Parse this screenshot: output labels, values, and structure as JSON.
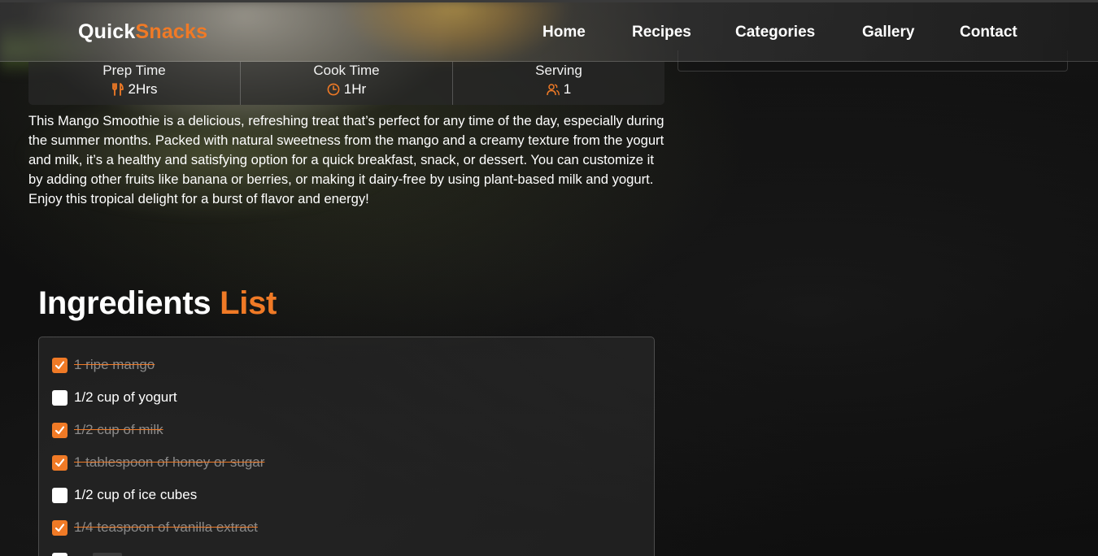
{
  "colors": {
    "accent": "#f07a26",
    "background": "#0e0e0e",
    "text": "#ffffff"
  },
  "navbar": {
    "brand_part1": "Quick",
    "brand_part2": "Snacks",
    "links": [
      {
        "label": "Home"
      },
      {
        "label": "Recipes"
      },
      {
        "label": "Categories"
      },
      {
        "label": "Gallery"
      },
      {
        "label": "Contact"
      }
    ]
  },
  "stats": [
    {
      "label": "Prep Time",
      "value": "2Hrs",
      "icon": "utensils-icon"
    },
    {
      "label": "Cook Time",
      "value": "1Hr",
      "icon": "clock-icon"
    },
    {
      "label": "Serving",
      "value": "1",
      "icon": "users-icon"
    }
  ],
  "description": "This Mango Smoothie is a delicious, refreshing treat that’s perfect for any time of the day, especially during the summer months. Packed with natural sweetness from the mango and a creamy texture from the yogurt and milk, it’s a healthy and satisfying option for a quick breakfast, snack, or dessert. You can customize it by adding other fruits like banana or berries, or making it dairy-free by using plant-based milk and yogurt. Enjoy this tropical delight for a burst of flavor and energy!",
  "ingredients": {
    "title_part1": "Ingredients",
    "title_part2": "List",
    "items": [
      {
        "label": "1 ripe mango",
        "checked": true
      },
      {
        "label": "1/2 cup of yogurt",
        "checked": false
      },
      {
        "label": "1/2 cup of milk",
        "checked": true
      },
      {
        "label": "1 tablespoon of honey or sugar",
        "checked": true
      },
      {
        "label": "1/2 cup of ice cubes",
        "checked": false
      },
      {
        "label": "1/4 teaspoon of vanilla extract",
        "checked": true
      }
    ]
  }
}
